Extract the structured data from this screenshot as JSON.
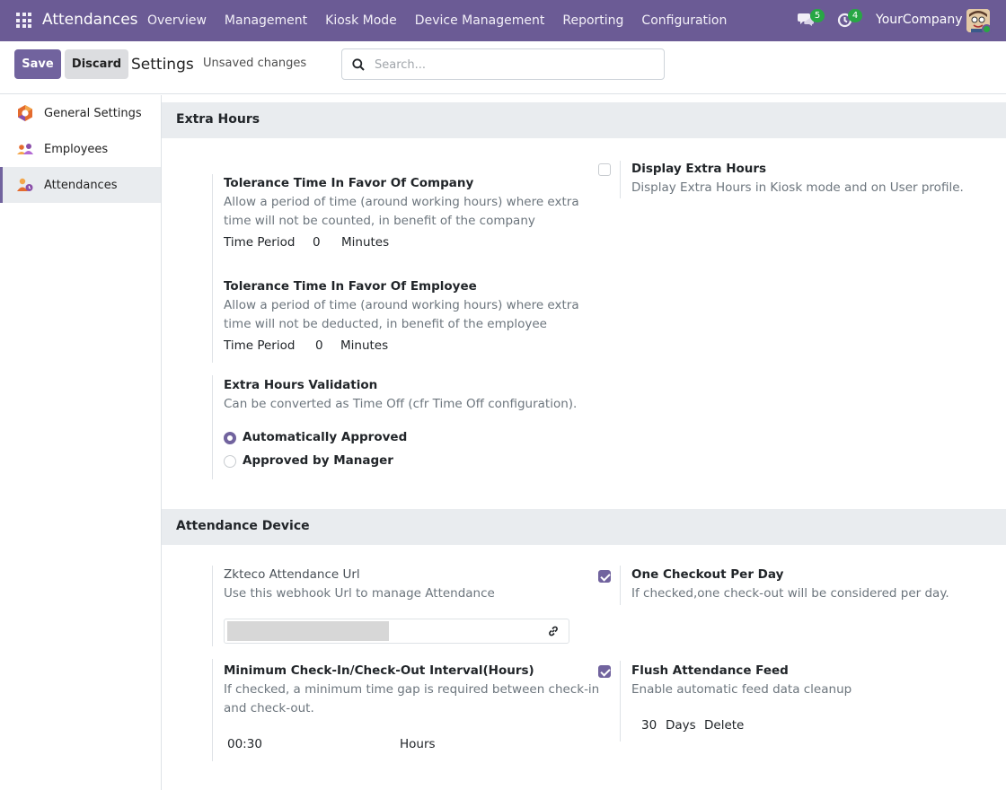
{
  "topbar": {
    "app_title": "Attendances",
    "menu": [
      "Overview",
      "Management",
      "Kiosk Mode",
      "Device Management",
      "Reporting",
      "Configuration"
    ],
    "messages_badge": "5",
    "activities_badge": "4",
    "company": "YourCompany",
    "color": "#6b5b95"
  },
  "control": {
    "save_label": "Save",
    "discard_label": "Discard",
    "title": "Settings",
    "status": "Unsaved changes",
    "search_placeholder": "Search..."
  },
  "sidebar": {
    "items": [
      {
        "label": "General Settings",
        "icon": "odoo-settings-icon"
      },
      {
        "label": "Employees",
        "icon": "employees-icon"
      },
      {
        "label": "Attendances",
        "icon": "attendances-icon",
        "active": true
      }
    ]
  },
  "extra_hours": {
    "heading": "Extra Hours",
    "company_tolerance": {
      "title": "Tolerance Time In Favor Of Company",
      "desc_line1": "Allow a period of time (around working hours) where extra",
      "desc_line2": "time will not be counted, in benefit of the company",
      "period_label": "Time Period",
      "value": "0",
      "unit": "Minutes"
    },
    "employee_tolerance": {
      "title": "Tolerance Time In Favor Of Employee",
      "desc_line1": "Allow a period of time (around working hours) where extra",
      "desc_line2": "time will not be deducted, in benefit of the employee",
      "period_label": "Time Period",
      "value": "0",
      "unit": "Minutes"
    },
    "validation": {
      "title": "Extra Hours Validation",
      "desc": "Can be converted as Time Off (cfr Time Off configuration).",
      "options": [
        "Automatically Approved",
        "Approved by Manager"
      ],
      "selected": "Automatically Approved"
    },
    "display": {
      "title": "Display Extra Hours",
      "desc": "Display Extra Hours in Kiosk mode and on User profile.",
      "checked": false
    }
  },
  "attendance_device": {
    "heading": "Attendance Device",
    "url": {
      "title": "Zkteco Attendance Url",
      "desc": "Use this webhook Url to manage Attendance"
    },
    "one_checkout": {
      "title": "One Checkout Per Day",
      "desc": "If checked,one check-out will be considered per day.",
      "checked": true
    },
    "min_interval": {
      "title": "Minimum Check-In/Check-Out Interval(Hours)",
      "desc_line1": "If checked, a minimum time gap is required between check-in",
      "desc_line2": "and check-out.",
      "value": "00:30",
      "unit": "Hours"
    },
    "flush_feed": {
      "title": "Flush Attendance Feed",
      "desc": "Enable automatic feed data cleanup",
      "value": "30",
      "unit": "Days",
      "action": "Delete",
      "checked": true
    }
  }
}
